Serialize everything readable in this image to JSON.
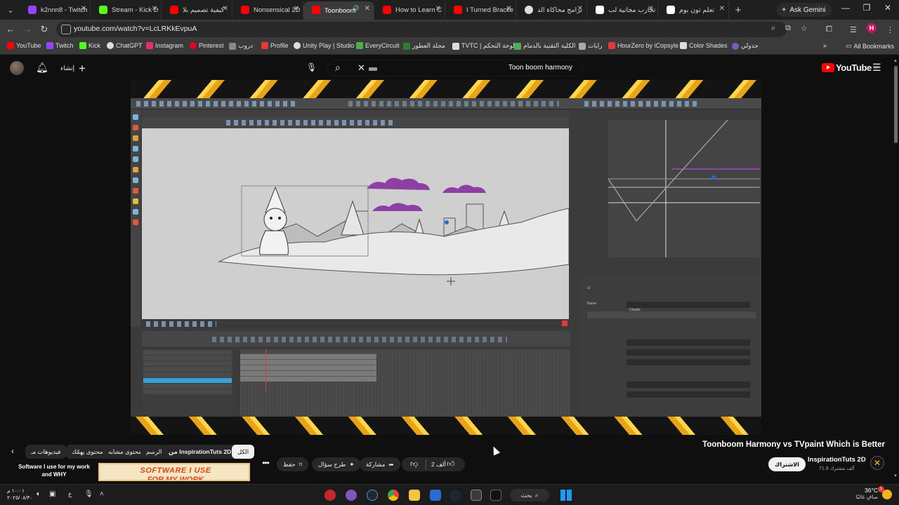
{
  "browser": {
    "tabs": [
      {
        "label": "k2nnn8 - Twitch",
        "color": "#9146ff",
        "active": false
      },
      {
        "label": "Stream - Kick D",
        "color": "#53fc18",
        "active": false
      },
      {
        "label": "كيفية تصميم بلا",
        "color": "#ff0000",
        "active": false
      },
      {
        "label": "Nonsensical 2D",
        "color": "#ff0000",
        "active": false
      },
      {
        "label": "Toonboom",
        "color": "#ff0000",
        "active": true
      },
      {
        "label": "How to Learn C",
        "color": "#ff0000",
        "active": false
      },
      {
        "label": "I Turned Bracke",
        "color": "#ff0000",
        "active": false
      },
      {
        "label": "برامج محاكاة الد",
        "color": "#dddddd",
        "active": false
      },
      {
        "label": "تجارب مجانية لب",
        "color": "#ffffff",
        "active": false
      },
      {
        "label": "تعلم تون بوم",
        "color": "#ffffff",
        "active": false
      }
    ],
    "gemini_label": "Ask Gemini",
    "url": "youtube.com/watch?v=LcLRKkEvpuA",
    "profile_initial": "H",
    "bookmarks": [
      {
        "label": "YouTube",
        "color": "#ff0000"
      },
      {
        "label": "Twitch",
        "color": "#9146ff"
      },
      {
        "label": "Kick",
        "color": "#53fc18"
      },
      {
        "label": "ChatGPT",
        "color": "#dddddd"
      },
      {
        "label": "Instagram",
        "color": "#e1306c"
      },
      {
        "label": "Pinterest",
        "color": "#e60023"
      },
      {
        "label": "دروب",
        "color": "#888888"
      },
      {
        "label": "Profile",
        "color": "#e53935"
      },
      {
        "label": "Unity Play | Studio",
        "color": "#dddddd"
      },
      {
        "label": "EveryCircuit",
        "color": "#4caf50"
      },
      {
        "label": "مجلة العطور",
        "color": "#2e7d32"
      },
      {
        "label": "TVTC | لوحة التحكم",
        "color": "#dddddd"
      },
      {
        "label": "الكلية التقنية بالدمام",
        "color": "#4caf50"
      },
      {
        "label": "رايات",
        "color": "#aaaaaa"
      },
      {
        "label": "HourZero by iCopsyle",
        "color": "#e53935"
      },
      {
        "label": "Color Shades",
        "color": "#dddddd"
      },
      {
        "label": "جدولي",
        "color": "#7e57c2"
      }
    ],
    "all_bookmarks": "All Bookmarks"
  },
  "youtube": {
    "create_label": "إنشاء",
    "search_query": "Toon boom harmony",
    "logo_text": "YouTube",
    "logo_region": "SA"
  },
  "video": {
    "title": "Toonboom Harmony vs TVpaint Which is Better",
    "channel": "InspirationTuts 2D",
    "subscribers": "71.9 ألف مشترك",
    "subscribe_label": "الاشتراك",
    "likes": "2 ألف",
    "share_label": "مشاركة",
    "ask_label": "طرح سؤال",
    "save_label": "حفظ",
    "app_layer_name": "Clouds"
  },
  "chips": [
    {
      "label": "الكل",
      "active": true
    },
    {
      "label": "من InspirationTuts 2D",
      "active": false,
      "bold": true
    },
    {
      "label": "الرسم",
      "active": false
    },
    {
      "label": "محتوى مشابه",
      "active": false
    },
    {
      "label": "محتوى يهمّك",
      "active": false
    },
    {
      "label": "فيديوهات مـ",
      "active": false
    }
  ],
  "recommendation": {
    "title": "Software I use for my work and WHY",
    "thumb_line1": "SOFTWARE I USE",
    "thumb_line2": "FOR MY WORK"
  },
  "taskbar": {
    "temperature": "36°C",
    "weather_desc": "صافٍ غالبًا",
    "search_label": "بحث",
    "time": "١٠:٠١ م",
    "date": "٢٠٢٥/٠٨/٣٠",
    "lang": "ع",
    "notification_count": "1"
  }
}
